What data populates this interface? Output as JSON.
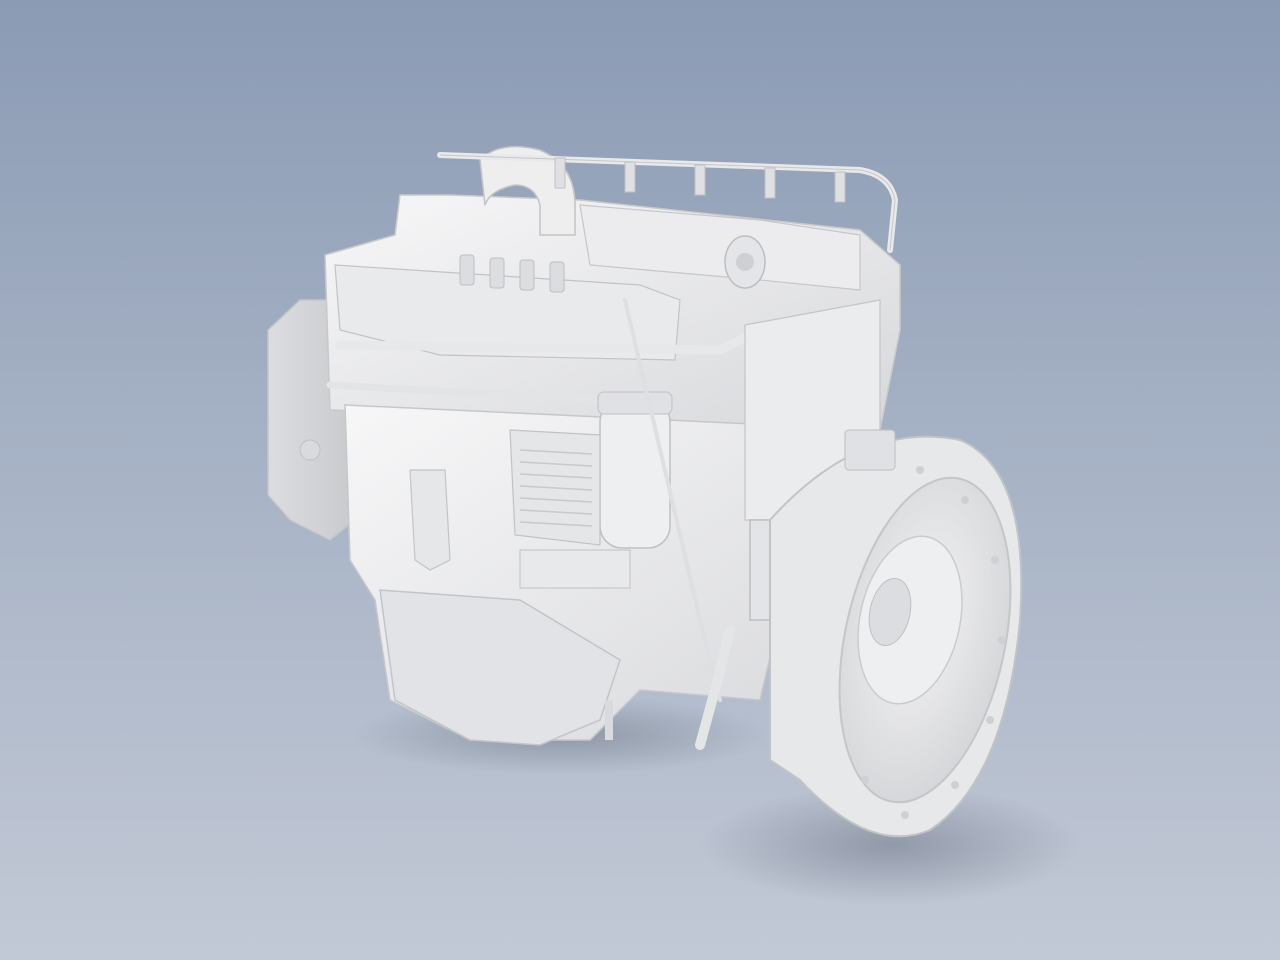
{
  "scene": {
    "subject": "engine-model",
    "colors": {
      "background_top": "#8b9bb4",
      "background_bottom": "#c2c9d6",
      "model_base": "#e6e6e8",
      "model_highlight": "#f7f7f8",
      "model_shadow": "#c9cacd",
      "floor_shadow": "#6f7787"
    }
  }
}
